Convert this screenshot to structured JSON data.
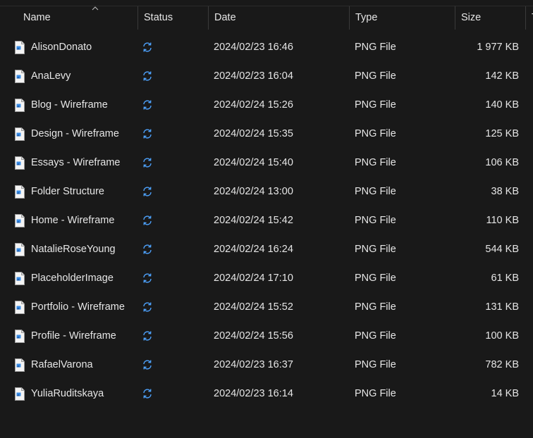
{
  "columns": {
    "name": "Name",
    "status": "Status",
    "date": "Date",
    "type": "Type",
    "size": "Size",
    "extra": "T"
  },
  "accent": "#4ea3ff",
  "icons": {
    "file": "png-file-icon",
    "status": "sync-pending-icon",
    "sort": "sort-ascending-icon"
  },
  "files": [
    {
      "name": "AlisonDonato",
      "date": "2024/02/23 16:46",
      "type": "PNG File",
      "size": "1 977 KB"
    },
    {
      "name": "AnaLevy",
      "date": "2024/02/23 16:04",
      "type": "PNG File",
      "size": "142 KB"
    },
    {
      "name": "Blog - Wireframe",
      "date": "2024/02/24 15:26",
      "type": "PNG File",
      "size": "140 KB"
    },
    {
      "name": "Design - Wireframe",
      "date": "2024/02/24 15:35",
      "type": "PNG File",
      "size": "125 KB"
    },
    {
      "name": "Essays - Wireframe",
      "date": "2024/02/24 15:40",
      "type": "PNG File",
      "size": "106 KB"
    },
    {
      "name": "Folder Structure",
      "date": "2024/02/24 13:00",
      "type": "PNG File",
      "size": "38 KB"
    },
    {
      "name": "Home - Wireframe",
      "date": "2024/02/24 15:42",
      "type": "PNG File",
      "size": "110 KB"
    },
    {
      "name": "NatalieRoseYoung",
      "date": "2024/02/24 16:24",
      "type": "PNG File",
      "size": "544 KB"
    },
    {
      "name": "PlaceholderImage",
      "date": "2024/02/24 17:10",
      "type": "PNG File",
      "size": "61 KB"
    },
    {
      "name": "Portfolio - Wireframe",
      "date": "2024/02/24 15:52",
      "type": "PNG File",
      "size": "131 KB"
    },
    {
      "name": "Profile - Wireframe",
      "date": "2024/02/24 15:56",
      "type": "PNG File",
      "size": "100 KB"
    },
    {
      "name": "RafaelVarona",
      "date": "2024/02/23 16:37",
      "type": "PNG File",
      "size": "782 KB"
    },
    {
      "name": "YuliaRuditskaya",
      "date": "2024/02/23 16:14",
      "type": "PNG File",
      "size": "14 KB"
    }
  ]
}
